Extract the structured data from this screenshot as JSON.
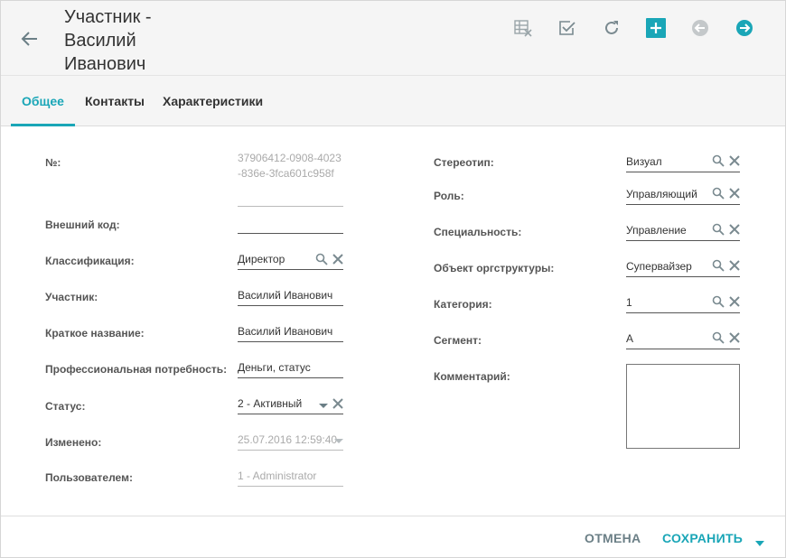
{
  "header": {
    "title": "Участник - Василий Иванович"
  },
  "tabs": [
    {
      "label": "Общее"
    },
    {
      "label": "Контакты"
    },
    {
      "label": "Характеристики"
    }
  ],
  "left_fields": [
    {
      "label": "№:",
      "value": "37906412-0908-4023-836e-3fca601c958f"
    },
    {
      "label": "Внешний код:",
      "value": ""
    },
    {
      "label": "Классификация:",
      "value": "Директор"
    },
    {
      "label": "Участник:",
      "value": "Василий Иванович"
    },
    {
      "label": "Краткое название:",
      "value": "Василий Иванович"
    },
    {
      "label": "Профессиональная потребность:",
      "value": "Деньги, статус"
    },
    {
      "label": "Статус:",
      "value": "2 - Активный"
    },
    {
      "label": "Изменено:",
      "value": "25.07.2016 12:59:40"
    },
    {
      "label": "Пользователем:",
      "value": "1 - Administrator"
    }
  ],
  "right_fields": [
    {
      "label": "Стереотип:",
      "value": "Визуал"
    },
    {
      "label": "Роль:",
      "value": "Управляющий"
    },
    {
      "label": "Специальность:",
      "value": "Управление"
    },
    {
      "label": "Объект оргструктуры:",
      "value": "Супервайзер"
    },
    {
      "label": "Категория:",
      "value": "1"
    },
    {
      "label": "Сегмент:",
      "value": "А"
    },
    {
      "label": "Комментарий:",
      "value": ""
    }
  ],
  "footer": {
    "cancel_label": "ОТМЕНА",
    "save_label": "СОХРАНИТЬ"
  },
  "colors": {
    "accent": "#1aa6b7",
    "header_bg": "#f5f5f5",
    "toolbar_icon": "#7a8a90"
  }
}
